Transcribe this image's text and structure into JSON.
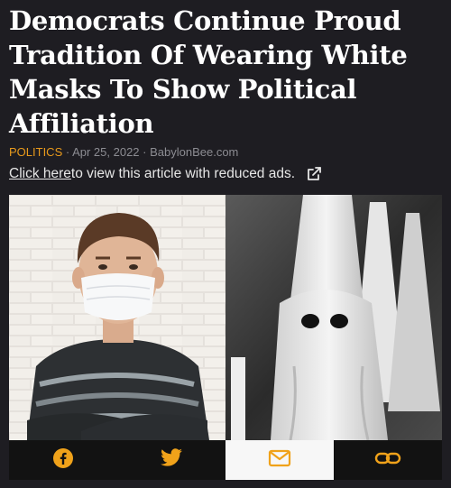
{
  "article": {
    "headline": "Democrats Continue Proud Tradition Of Wearing White Masks To Show Political Affiliation",
    "category": "POLITICS",
    "separator_1": " · ",
    "date": "Apr 25, 2022",
    "separator_2": " · ",
    "source": "BabylonBee.com"
  },
  "reduced_ads": {
    "link_text": "Click here",
    "rest_text": " to view this article with reduced ads."
  },
  "share_bar": {
    "buttons": [
      {
        "icon": "facebook-icon",
        "active": false
      },
      {
        "icon": "twitter-icon",
        "active": false
      },
      {
        "icon": "email-icon",
        "active": true
      },
      {
        "icon": "link-icon",
        "active": false
      }
    ]
  },
  "colors": {
    "background": "#1e1d22",
    "category": "#e89a1c",
    "meta": "#8c8c92",
    "icon_accent": "#f0a21a",
    "share_bar": "#121212"
  }
}
